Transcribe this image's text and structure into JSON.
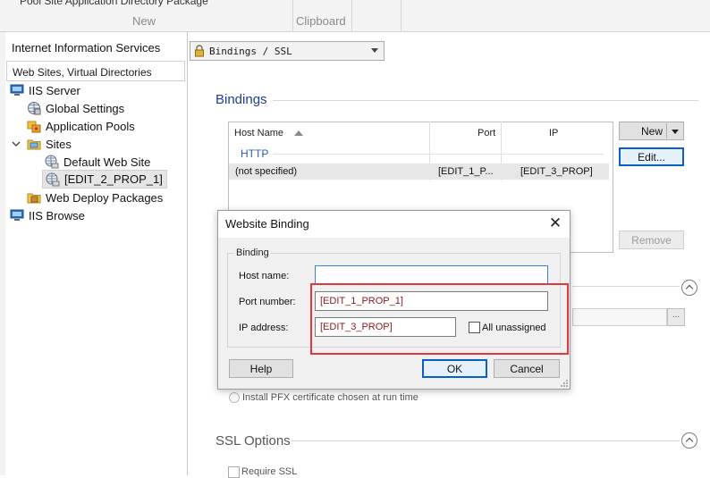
{
  "ribbon": {
    "top_text": "Pool      Site   Application Directory    Package",
    "group_new": "New",
    "group_clipboard": "Clipboard"
  },
  "left": {
    "title": "Internet Information Services",
    "subheader": "Web Sites, Virtual Directories",
    "tree": [
      {
        "label": "IIS Server",
        "icon": "server-icon"
      },
      {
        "label": "Global Settings",
        "icon": "globe-settings-icon"
      },
      {
        "label": "Application Pools",
        "icon": "app-pools-icon"
      },
      {
        "label": "Sites",
        "icon": "folder-sites-icon"
      },
      {
        "label": "Default Web Site",
        "icon": "website-globe-icon"
      },
      {
        "label": "[EDIT_2_PROP_1]",
        "icon": "website-globe-icon"
      },
      {
        "label": "Web Deploy Packages",
        "icon": "package-folder-icon"
      },
      {
        "label": "IIS Browse",
        "icon": "server-icon"
      }
    ]
  },
  "toolbar": {
    "combo_value": "Bindings / SSL"
  },
  "bindings": {
    "section_title": "Bindings",
    "columns": {
      "host": "Host Name",
      "port": "Port",
      "ip": "IP"
    },
    "group": "HTTP",
    "row": {
      "host": "(not specified)",
      "port": "[EDIT_1_P...",
      "ip": "[EDIT_3_PROP]"
    },
    "buttons": {
      "new": "New",
      "edit": "Edit...",
      "remove": "Remove"
    }
  },
  "ssl": {
    "radio_label": "Install PFX certificate chosen at run time",
    "options_title": "SSL Options",
    "require_ssl": "Require SSL",
    "picker": "..."
  },
  "dialog": {
    "title": "Website Binding",
    "close": "✕",
    "group": "Binding",
    "host_label": "Host name:",
    "host_value": "",
    "port_label": "Port number:",
    "port_value": "[EDIT_1_PROP_1]",
    "ip_label": "IP address:",
    "ip_value": "[EDIT_3_PROP]",
    "all_unassigned": "All unassigned",
    "help": "Help",
    "ok": "OK",
    "cancel": "Cancel"
  },
  "colors": {
    "accent_blue": "#1f3d8f",
    "highlight_red": "#e0383c",
    "field_text": "#8b1a1a"
  }
}
